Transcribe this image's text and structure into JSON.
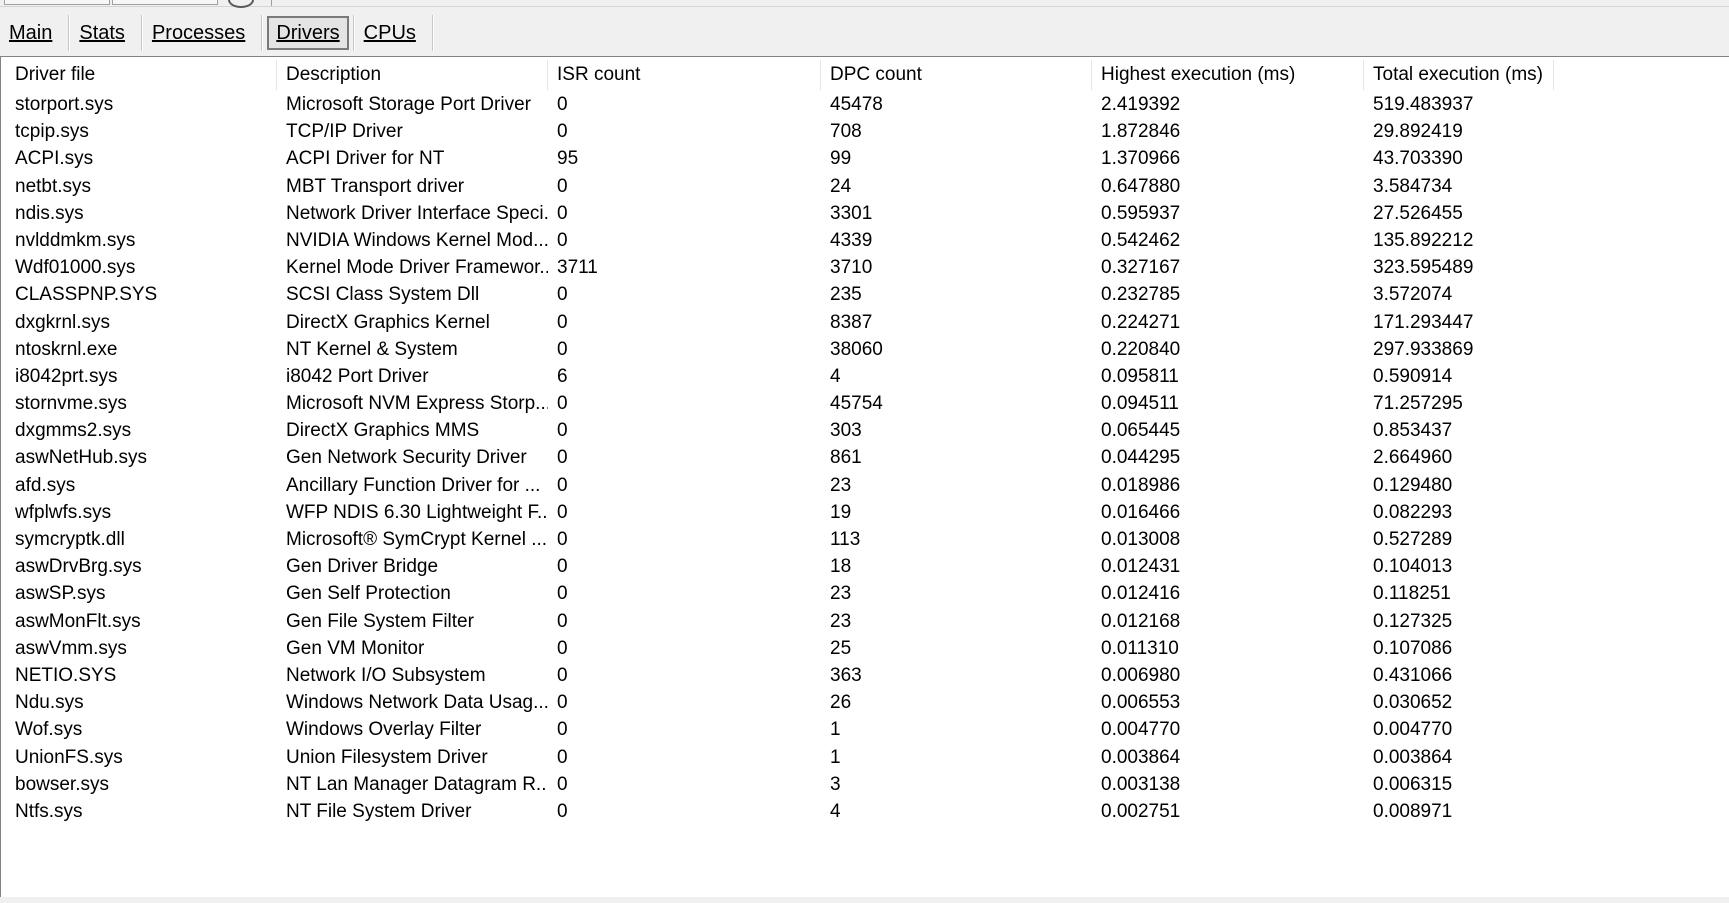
{
  "tabs": [
    {
      "label": "Main",
      "active": false
    },
    {
      "label": "Stats",
      "active": false
    },
    {
      "label": "Processes",
      "active": false
    },
    {
      "label": "Drivers",
      "active": true
    },
    {
      "label": "CPUs",
      "active": false
    }
  ],
  "table": {
    "columns": [
      "Driver file",
      "Description",
      "ISR count",
      "DPC count",
      "Highest execution (ms)",
      "Total execution (ms)"
    ],
    "rows": [
      [
        "storport.sys",
        "Microsoft Storage Port Driver",
        "0",
        "45478",
        "2.419392",
        "519.483937"
      ],
      [
        "tcpip.sys",
        "TCP/IP Driver",
        "0",
        "708",
        "1.872846",
        "29.892419"
      ],
      [
        "ACPI.sys",
        "ACPI Driver for NT",
        "95",
        "99",
        "1.370966",
        "43.703390"
      ],
      [
        "netbt.sys",
        "MBT Transport driver",
        "0",
        "24",
        "0.647880",
        "3.584734"
      ],
      [
        "ndis.sys",
        "Network Driver Interface Speci...",
        "0",
        "3301",
        "0.595937",
        "27.526455"
      ],
      [
        "nvlddmkm.sys",
        "NVIDIA Windows Kernel Mod...",
        "0",
        "4339",
        "0.542462",
        "135.892212"
      ],
      [
        "Wdf01000.sys",
        "Kernel Mode Driver Framewor...",
        "3711",
        "3710",
        "0.327167",
        "323.595489"
      ],
      [
        "CLASSPNP.SYS",
        "SCSI Class System Dll",
        "0",
        "235",
        "0.232785",
        "3.572074"
      ],
      [
        "dxgkrnl.sys",
        "DirectX Graphics Kernel",
        "0",
        "8387",
        "0.224271",
        "171.293447"
      ],
      [
        "ntoskrnl.exe",
        "NT Kernel & System",
        "0",
        "38060",
        "0.220840",
        "297.933869"
      ],
      [
        "i8042prt.sys",
        "i8042 Port Driver",
        "6",
        "4",
        "0.095811",
        "0.590914"
      ],
      [
        "stornvme.sys",
        "Microsoft NVM Express Storp...",
        "0",
        "45754",
        "0.094511",
        "71.257295"
      ],
      [
        "dxgmms2.sys",
        "DirectX Graphics MMS",
        "0",
        "303",
        "0.065445",
        "0.853437"
      ],
      [
        "aswNetHub.sys",
        "Gen Network Security Driver",
        "0",
        "861",
        "0.044295",
        "2.664960"
      ],
      [
        "afd.sys",
        "Ancillary Function Driver for ...",
        "0",
        "23",
        "0.018986",
        "0.129480"
      ],
      [
        "wfplwfs.sys",
        "WFP NDIS 6.30 Lightweight F...",
        "0",
        "19",
        "0.016466",
        "0.082293"
      ],
      [
        "symcryptk.dll",
        "Microsoft® SymCrypt Kernel ...",
        "0",
        "113",
        "0.013008",
        "0.527289"
      ],
      [
        "aswDrvBrg.sys",
        "Gen Driver Bridge",
        "0",
        "18",
        "0.012431",
        "0.104013"
      ],
      [
        "aswSP.sys",
        "Gen Self Protection",
        "0",
        "23",
        "0.012416",
        "0.118251"
      ],
      [
        "aswMonFlt.sys",
        "Gen File System Filter",
        "0",
        "23",
        "0.012168",
        "0.127325"
      ],
      [
        "aswVmm.sys",
        "Gen VM Monitor",
        "0",
        "25",
        "0.011310",
        "0.107086"
      ],
      [
        "NETIO.SYS",
        "Network I/O Subsystem",
        "0",
        "363",
        "0.006980",
        "0.431066"
      ],
      [
        "Ndu.sys",
        "Windows Network Data Usag...",
        "0",
        "26",
        "0.006553",
        "0.030652"
      ],
      [
        "Wof.sys",
        "Windows Overlay Filter",
        "0",
        "1",
        "0.004770",
        "0.004770"
      ],
      [
        "UnionFS.sys",
        "Union Filesystem Driver",
        "0",
        "1",
        "0.003864",
        "0.003864"
      ],
      [
        "bowser.sys",
        "NT Lan Manager Datagram R...",
        "0",
        "3",
        "0.003138",
        "0.006315"
      ],
      [
        "Ntfs.sys",
        "NT File System Driver",
        "0",
        "4",
        "0.002751",
        "0.008971"
      ]
    ]
  }
}
